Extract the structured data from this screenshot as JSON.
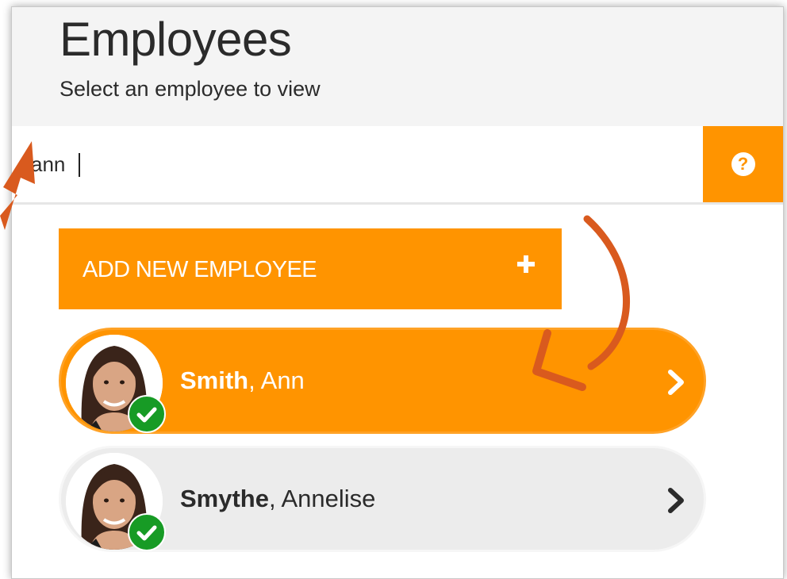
{
  "header": {
    "title": "Employees",
    "subtitle": "Select an employee to view"
  },
  "search": {
    "value": "ann",
    "help_icon": "question-circle-icon"
  },
  "add_button": {
    "label": "ADD NEW EMPLOYEE",
    "icon": "plus-icon"
  },
  "employees": [
    {
      "last_name": "Smith",
      "first_name": "Ann",
      "selected": true,
      "status": "verified"
    },
    {
      "last_name": "Smythe",
      "first_name": "Annelise",
      "selected": false,
      "status": "verified"
    }
  ],
  "colors": {
    "accent": "#ff9400",
    "annotation_arrow": "#d95a1e",
    "badge_green": "#179b25",
    "row_gray": "#ececec"
  }
}
